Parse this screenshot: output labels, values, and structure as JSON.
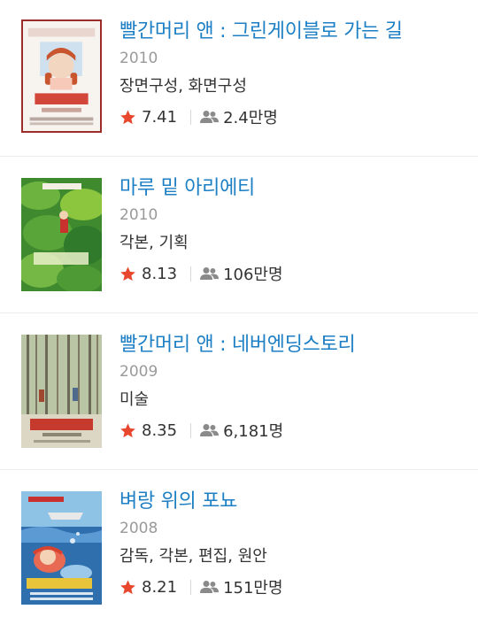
{
  "colors": {
    "title": "#1d7fc4",
    "star": "#e8472e",
    "meta_text": "#333333",
    "year_text": "#9a9a9a"
  },
  "movies": [
    {
      "title": "빨간머리 앤 : 그린게이블로 가는 길",
      "year": "2010",
      "role": "장면구성, 화면구성",
      "rating": "7.41",
      "audience": "2.4만명",
      "poster_icon": "poster-anne-green-gables"
    },
    {
      "title": "마루 밑 아리에티",
      "year": "2010",
      "role": "각본, 기획",
      "rating": "8.13",
      "audience": "106만명",
      "poster_icon": "poster-arrietty"
    },
    {
      "title": "빨간머리 앤 : 네버엔딩스토리",
      "year": "2009",
      "role": "미술",
      "rating": "8.35",
      "audience": "6,181명",
      "poster_icon": "poster-anne-neverending"
    },
    {
      "title": "벼랑 위의 포뇨",
      "year": "2008",
      "role": "감독, 각본, 편집, 원안",
      "rating": "8.21",
      "audience": "151만명",
      "poster_icon": "poster-ponyo"
    }
  ]
}
